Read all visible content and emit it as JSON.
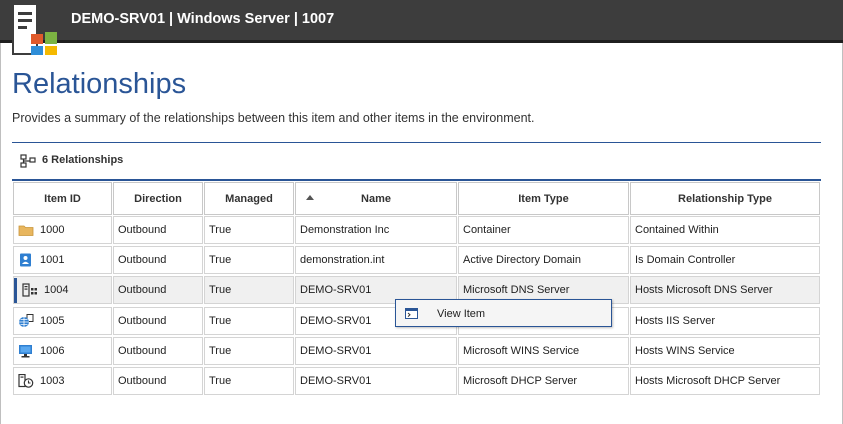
{
  "window": {
    "title": "DEMO-SRV01 | Windows Server | 1007",
    "icon": "server-windows-icon"
  },
  "page": {
    "title": "Relationships",
    "description": "Provides a summary of the relationships between this item and other items in the environment."
  },
  "toolbar": {
    "count_label": "6 Relationships",
    "icon": "relationships-icon"
  },
  "grid": {
    "columns": [
      "Item ID",
      "Direction",
      "Managed",
      "Name",
      "Item Type",
      "Relationship Type"
    ],
    "sort": {
      "column": "Name",
      "direction": "ascending"
    },
    "rows": [
      {
        "id": "1000",
        "icon": "folder-icon",
        "direction": "Outbound",
        "managed": "True",
        "name": "Demonstration Inc",
        "item_type": "Container",
        "relationship_type": "Contained Within"
      },
      {
        "id": "1001",
        "icon": "active-directory-domain-icon",
        "direction": "Outbound",
        "managed": "True",
        "name": "demonstration.int",
        "item_type": "Active Directory Domain",
        "relationship_type": "Is Domain Controller"
      },
      {
        "id": "1004",
        "icon": "dns-server-icon",
        "direction": "Outbound",
        "managed": "True",
        "name": "DEMO-SRV01",
        "item_type": "Microsoft DNS Server",
        "relationship_type": "Hosts Microsoft DNS Server",
        "selected": true
      },
      {
        "id": "1005",
        "icon": "iis-web-server-icon",
        "direction": "Outbound",
        "managed": "True",
        "name": "DEMO-SRV01",
        "item_type": "",
        "relationship_type": "Hosts IIS Server"
      },
      {
        "id": "1006",
        "icon": "wins-service-icon",
        "direction": "Outbound",
        "managed": "True",
        "name": "DEMO-SRV01",
        "item_type": "Microsoft WINS Service",
        "relationship_type": "Hosts WINS Service"
      },
      {
        "id": "1003",
        "icon": "dhcp-server-icon",
        "direction": "Outbound",
        "managed": "True",
        "name": "DEMO-SRV01",
        "item_type": "Microsoft DHCP Server",
        "relationship_type": "Hosts Microsoft DHCP Server"
      }
    ]
  },
  "context_menu": {
    "items": [
      {
        "label": "View Item",
        "icon": "view-item-icon"
      }
    ]
  },
  "colors": {
    "accent": "#2a5596",
    "titlebar": "#3d3d3d",
    "selected_row": "#f0f0f0"
  }
}
